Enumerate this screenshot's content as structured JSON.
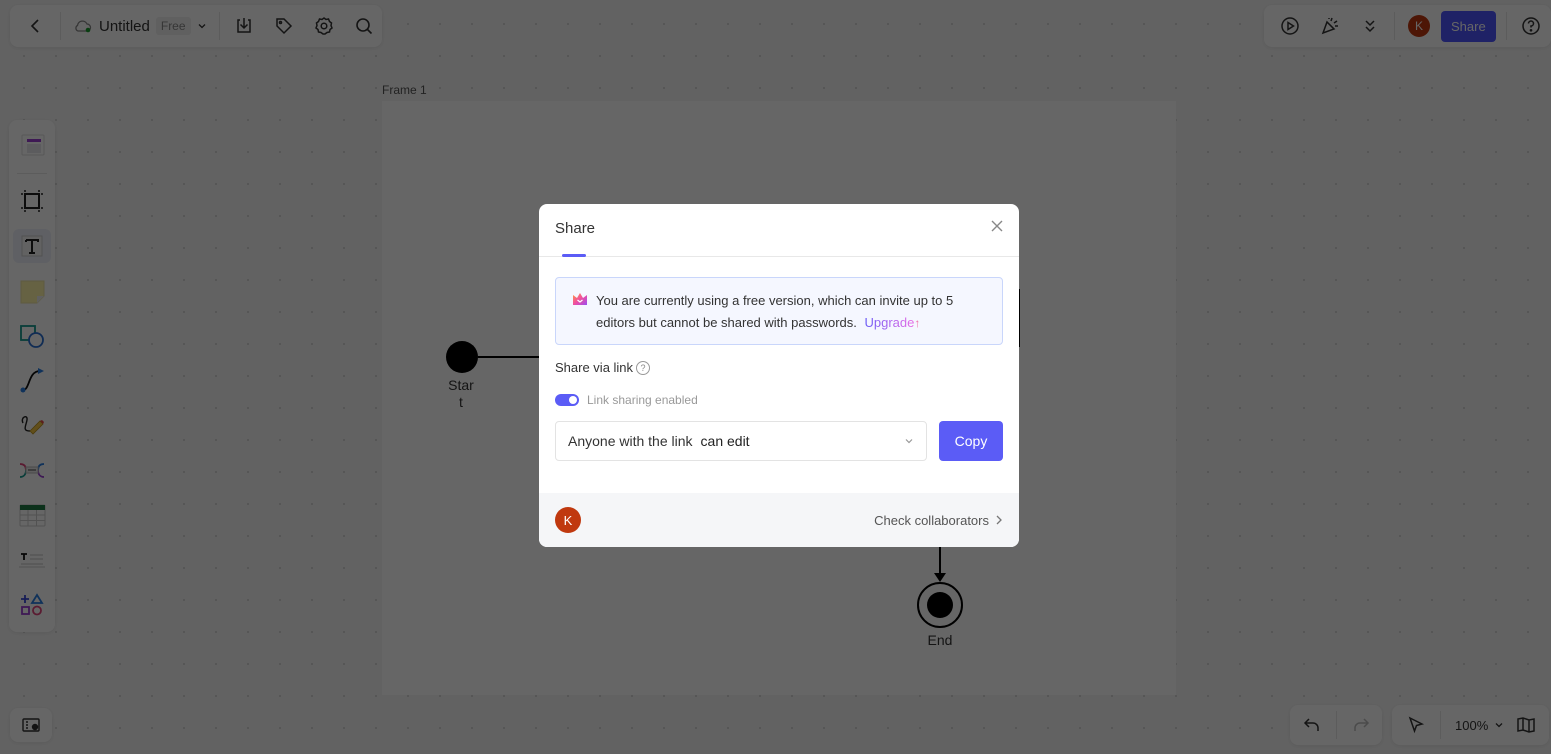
{
  "header": {
    "back_icon": "chevron-left-icon",
    "cloud_icon": "cloud-synced-icon",
    "title": "Untitled",
    "plan_badge": "Free",
    "dropdown_icon": "chevron-down-icon",
    "export_icon": "download-icon",
    "tag_icon": "tag-icon",
    "settings_icon": "gear-icon",
    "search_icon": "search-icon"
  },
  "header_right": {
    "present_icon": "play-icon",
    "celebrate_icon": "party-popper-icon",
    "more_icon": "double-chevron-down-icon",
    "user_initial": "K",
    "share_label": "Share",
    "help_icon": "help-icon"
  },
  "left_toolbar": {
    "items": [
      {
        "name": "template",
        "icon": "template-icon"
      },
      {
        "name": "frame",
        "icon": "frame-icon"
      },
      {
        "name": "text",
        "icon": "text-icon"
      },
      {
        "name": "sticky-note",
        "icon": "sticky-note-icon"
      },
      {
        "name": "shapes",
        "icon": "shapes-icon"
      },
      {
        "name": "connector",
        "icon": "connector-icon"
      },
      {
        "name": "pen",
        "icon": "pen-icon"
      },
      {
        "name": "mind-map",
        "icon": "mind-map-icon"
      },
      {
        "name": "table",
        "icon": "table-icon"
      },
      {
        "name": "text-block",
        "icon": "text-block-icon"
      },
      {
        "name": "more-shapes",
        "icon": "more-shapes-icon"
      }
    ]
  },
  "canvas": {
    "frame_label": "Frame 1",
    "start_label_line1": "Star",
    "start_label_line2": "t",
    "end_label": "End"
  },
  "bottom": {
    "minimap_icon": "map-pin-icon",
    "undo_icon": "undo-icon",
    "redo_icon": "redo-icon",
    "select_icon": "pointer-icon",
    "zoom_level": "100%",
    "book_icon": "book-open-icon"
  },
  "modal": {
    "title": "Share",
    "close_icon": "close-icon",
    "notice_text": "You are currently using a free version, which can invite up to 5 editors but cannot be shared with passwords.",
    "upgrade_label": "Upgrade",
    "share_via_link": "Share via link",
    "help_mark": "?",
    "toggle_label": "Link sharing enabled",
    "toggle_on": true,
    "permission_prefix": "Anyone with the link",
    "permission_value": "can edit",
    "copy_label": "Copy",
    "collaborator_initial": "K",
    "check_collaborators": "Check collaborators"
  },
  "colors": {
    "accent": "#5b5cf6",
    "avatar": "#c0390f",
    "notice_bg": "#f5f7ff"
  }
}
